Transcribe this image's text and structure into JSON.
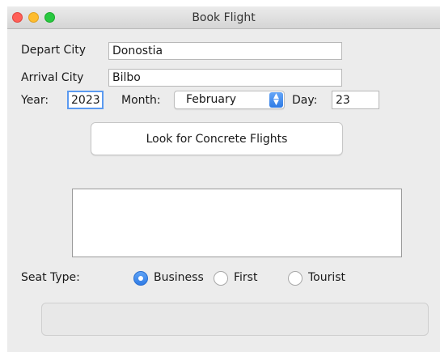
{
  "window": {
    "title": "Book Flight"
  },
  "form": {
    "depart_city_label": "Depart City",
    "depart_city_value": "Donostia",
    "arrival_city_label": "Arrival City",
    "arrival_city_value": "Bilbo",
    "year_label": "Year:",
    "year_value": "2023",
    "month_label": "Month:",
    "month_value": "February",
    "day_label": "Day:",
    "day_value": "23"
  },
  "actions": {
    "look_button_label": "Look for Concrete Flights"
  },
  "seat": {
    "label": "Seat Type:",
    "options": [
      {
        "label": "Business",
        "selected": true
      },
      {
        "label": "First",
        "selected": false
      },
      {
        "label": "Tourist",
        "selected": false
      }
    ]
  },
  "colors": {
    "close": "#ff5f57",
    "minimize": "#febc2e",
    "zoom": "#28c840",
    "accent": "#2f7be5",
    "window_bg": "#ececec"
  },
  "icons": {
    "month_arrow": "up-down-chevron-icon"
  }
}
